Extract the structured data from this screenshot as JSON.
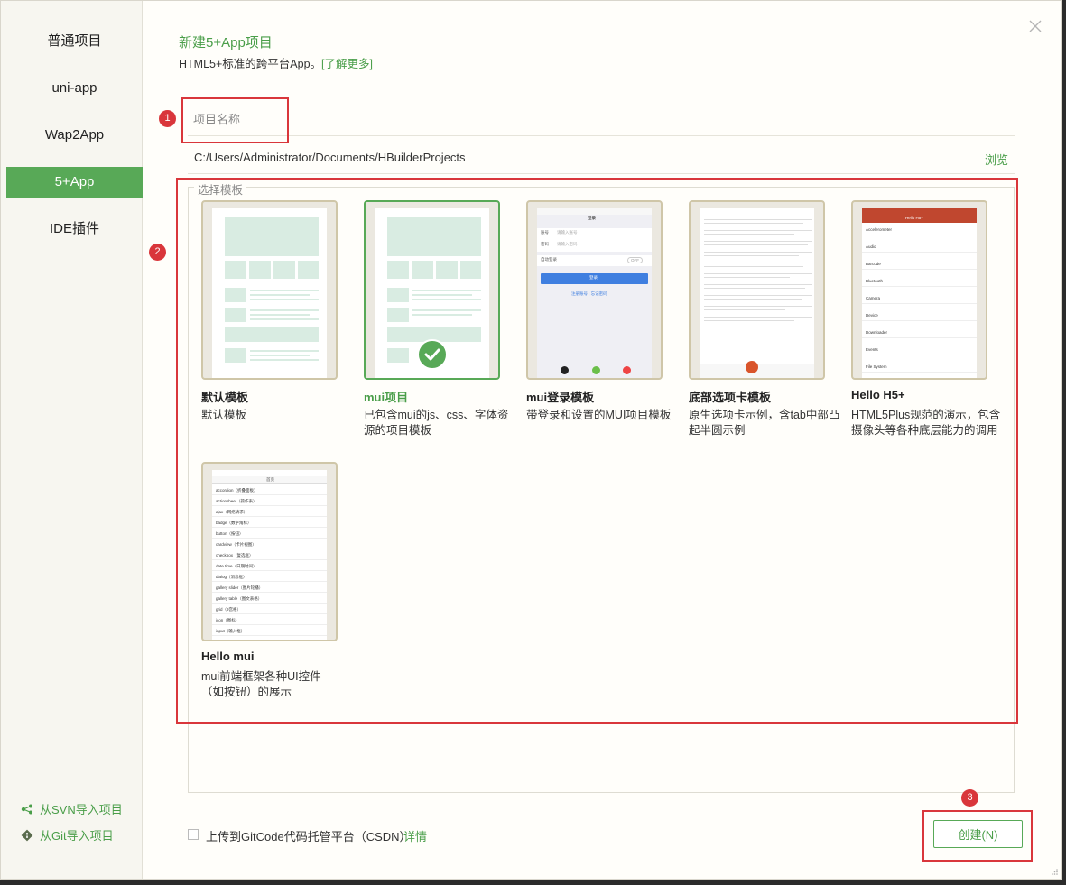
{
  "sidebar": {
    "items": [
      {
        "label": "普通项目"
      },
      {
        "label": "uni-app"
      },
      {
        "label": "Wap2App"
      },
      {
        "label": "5+App"
      },
      {
        "label": "IDE插件"
      }
    ],
    "active_index": 3,
    "import_svn": "从SVN导入项目",
    "import_git": "从Git导入项目"
  },
  "header": {
    "title": "新建5+App项目",
    "subtitle": "HTML5+标准的跨平台App。",
    "learn_more": "[了解更多]"
  },
  "form": {
    "name_placeholder": "项目名称",
    "name_value": "",
    "path": "C:/Users/Administrator/Documents/HBuilderProjects",
    "browse": "浏览"
  },
  "templates": {
    "legend": "选择模板",
    "selected_index": 1,
    "items": [
      {
        "title": "默认模板",
        "desc": "默认模板"
      },
      {
        "title": "mui项目",
        "desc": "已包含mui的js、css、字体资源的项目模板"
      },
      {
        "title": "mui登录模板",
        "desc": "带登录和设置的MUI项目模板"
      },
      {
        "title": "底部选项卡模板",
        "desc": "原生选项卡示例，含tab中部凸起半圆示例"
      },
      {
        "title": "Hello H5+",
        "desc": "HTML5Plus规范的演示，包含摄像头等各种底层能力的调用"
      },
      {
        "title": "Hello mui",
        "desc": "mui前端框架各种UI控件（如按钮）的展示"
      }
    ]
  },
  "thumb_text": {
    "login": {
      "header": "登录",
      "account": "账号",
      "account_ph": "请输入账号",
      "password": "密码",
      "password_ph": "请输入密码",
      "auto_login": "自动登录",
      "toggle": "OFF",
      "login_btn": "登录",
      "links": "注册账号  |  忘记密码"
    },
    "h5plus": {
      "header": "Hello H5+",
      "rows": [
        "Accelerometer",
        "Audio",
        "Barcode",
        "Bluetooth",
        "Camera",
        "Device",
        "Downloader",
        "Events",
        "File System"
      ]
    },
    "hellomui": {
      "header": "首页",
      "rows": [
        "accordion（折叠面板）",
        "actionsheet（操作表）",
        "ajax（网络请求）",
        "badge（数字角标）",
        "button（按钮）",
        "cardview（卡片视图）",
        "checkbox（复选框）",
        "date time（日期时间）",
        "dialog（消息框）",
        "gallery slider（图片轮播）",
        "gallery table（图文表格）",
        "grid（9宫格）",
        "icon（图标）",
        "input（输入框）"
      ]
    }
  },
  "footer": {
    "upload_label": "上传到GitCode代码托管平台（CSDN）",
    "detail": "详情",
    "create_button": "创建(N)"
  },
  "annotations": [
    "1",
    "2",
    "3"
  ],
  "colors": {
    "accent": "#58a957",
    "annotation": "#d9363b"
  }
}
